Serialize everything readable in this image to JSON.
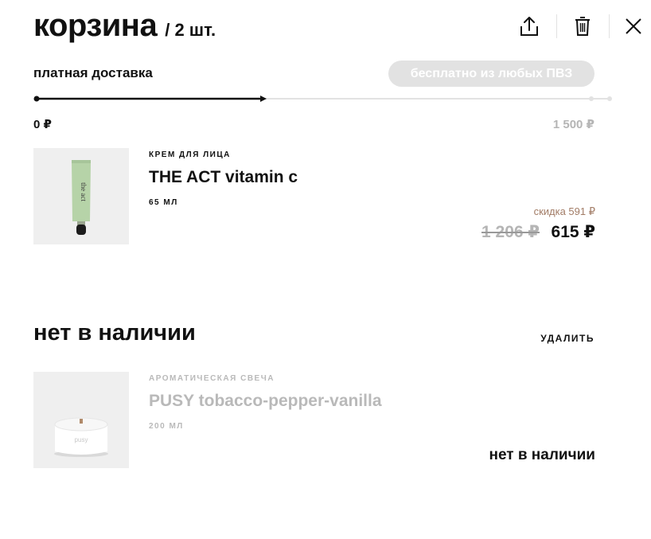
{
  "header": {
    "title": "корзина",
    "count": "/ 2 шт."
  },
  "toolbar": {
    "share_icon": "share-icon",
    "trash_icon": "trash-icon",
    "close_icon": "close-icon"
  },
  "delivery": {
    "label": "платная доставка",
    "free_badge": "бесплатно из любых ПВЗ",
    "progress_fraction": 0.41,
    "value_label": "0 ₽",
    "max_label": "1 500 ₽"
  },
  "cart_items": [
    {
      "category": "КРЕМ ДЛЯ ЛИЦА",
      "name": "THE ACT vitamin c",
      "volume": "65 МЛ",
      "discount": "скидка 591 ₽",
      "old_price": "1 206 ₽",
      "new_price": "615 ₽",
      "tube_text": "the act"
    }
  ],
  "unavailable_section": {
    "title": "нет в наличии",
    "delete_label": "УДАЛИТЬ",
    "items": [
      {
        "category": "АРОМАТИЧЕСКАЯ СВЕЧА",
        "name": "PUSY tobacco-pepper-vanilla",
        "volume": "200 МЛ",
        "status": "нет в наличии",
        "candle_text": "pusy"
      }
    ]
  },
  "colors": {
    "accent": "#111111",
    "discount": "#a27c66",
    "muted": "#b5b5b5",
    "pill_bg": "#e2e2e2",
    "tube": "#b6d3a8"
  }
}
